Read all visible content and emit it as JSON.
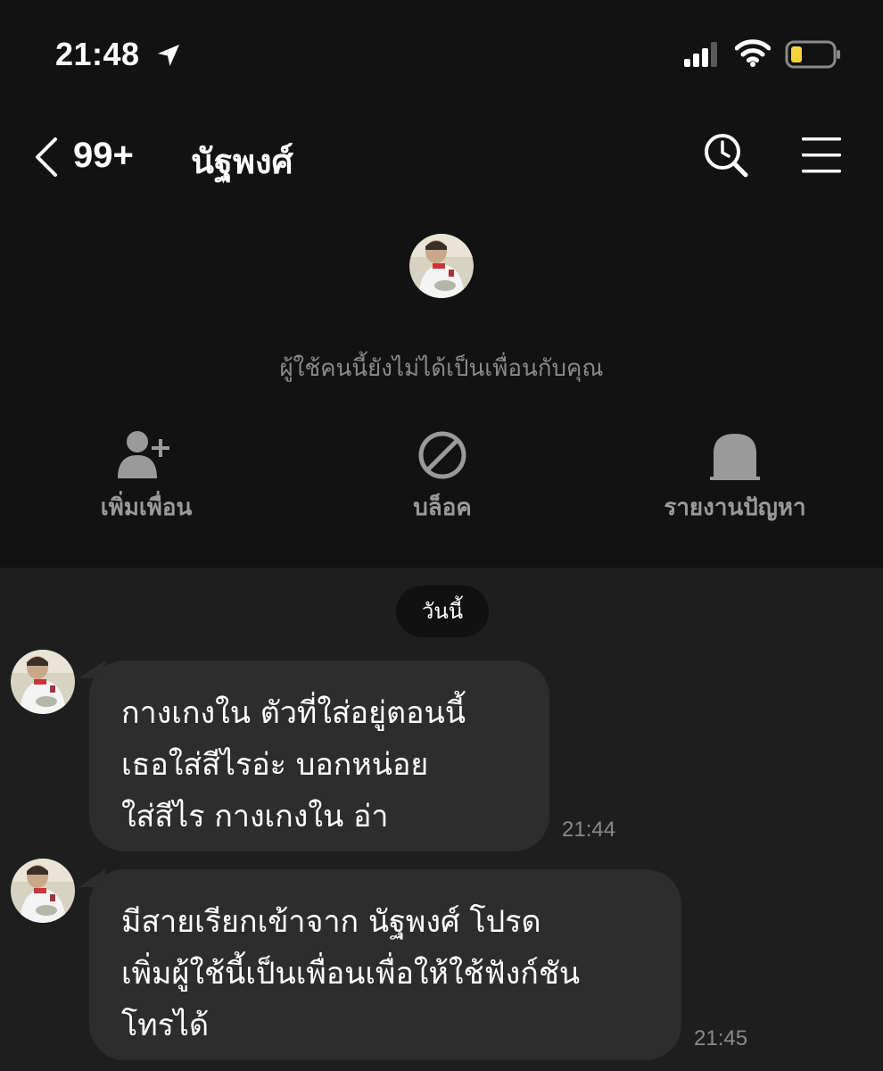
{
  "status_bar": {
    "time": "21:48",
    "icons": [
      "location-arrow-icon",
      "signal-icon",
      "wifi-icon",
      "battery-icon"
    ],
    "battery_color": "#f5d33b"
  },
  "header": {
    "back_count": "99+",
    "title": "นัฐพงศ์",
    "icons": [
      "back-chevron-icon",
      "search-history-icon",
      "menu-icon"
    ]
  },
  "profile": {
    "not_friend_text": "ผู้ใช้คนนี้ยังไม่ได้เป็นเพื่อนกับคุณ",
    "actions": [
      {
        "label": "เพิ่มเพื่อน",
        "icon": "add-friend-icon"
      },
      {
        "label": "บล็อค",
        "icon": "block-icon"
      },
      {
        "label": "รายงานปัญหา",
        "icon": "report-icon"
      }
    ]
  },
  "chat": {
    "date_label": "วันนี้",
    "messages": [
      {
        "text": "กางเกงใน ตัวที่ใส่อยู่ตอนนี้\nเธอใส่สีไรอ่ะ บอกหน่อย\nใส่สีไร กางเกงใน อ่า",
        "time": "21:44"
      },
      {
        "text": "มีสายเรียกเข้าจาก นัฐพงศ์ โปรด\nเพิ่มผู้ใช้นี้เป็นเพื่อนเพื่อให้ใช้ฟังก์ชัน\nโทรได้",
        "time": "21:45"
      }
    ]
  },
  "colors": {
    "top_background": "#121212",
    "chat_background": "#1e1e1e",
    "bubble": "#2d2d2d",
    "muted_text": "#8a8a8a"
  }
}
